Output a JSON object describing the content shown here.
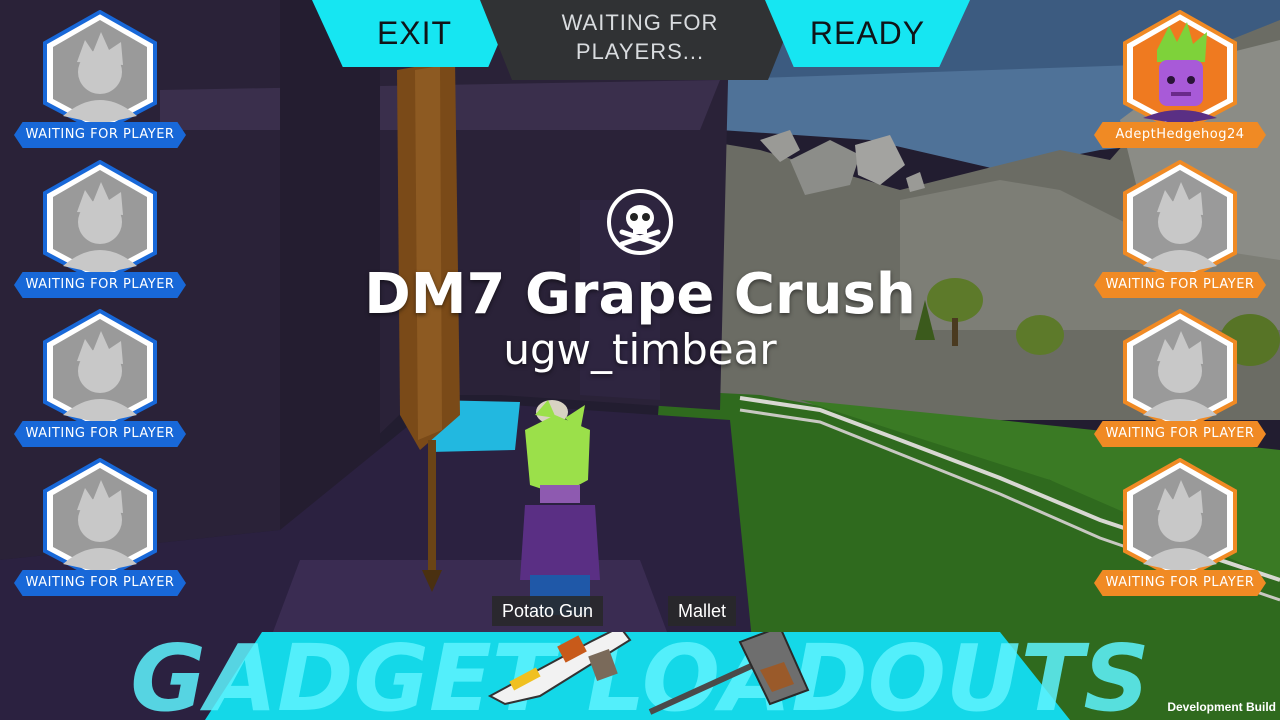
{
  "top_bar": {
    "exit_label": "EXIT",
    "status_line1": "WAITING FOR",
    "status_line2": "PLAYERS...",
    "ready_label": "READY"
  },
  "left_team": {
    "color": "#1868d8",
    "slots": [
      {
        "label": "WAITING FOR PLAYER"
      },
      {
        "label": "WAITING FOR PLAYER"
      },
      {
        "label": "WAITING FOR PLAYER"
      },
      {
        "label": "WAITING FOR PLAYER"
      }
    ]
  },
  "right_team": {
    "color": "#f08a24",
    "slots": [
      {
        "label": "AdeptHedgehog24",
        "avatar": "purple-character-avatar"
      },
      {
        "label": "WAITING FOR PLAYER"
      },
      {
        "label": "WAITING FOR PLAYER"
      },
      {
        "label": "WAITING FOR PLAYER"
      }
    ]
  },
  "map": {
    "icon": "skull-crossbones-icon",
    "title": "DM7 Grape Crush",
    "author": "ugw_timbear"
  },
  "loadout": {
    "banner_text": "GADGET LOADOUTS",
    "weapons": [
      "Potato Gun",
      "Mallet"
    ],
    "accent_color": "#16e6f2"
  },
  "footer": {
    "build_label": "Development Build"
  }
}
